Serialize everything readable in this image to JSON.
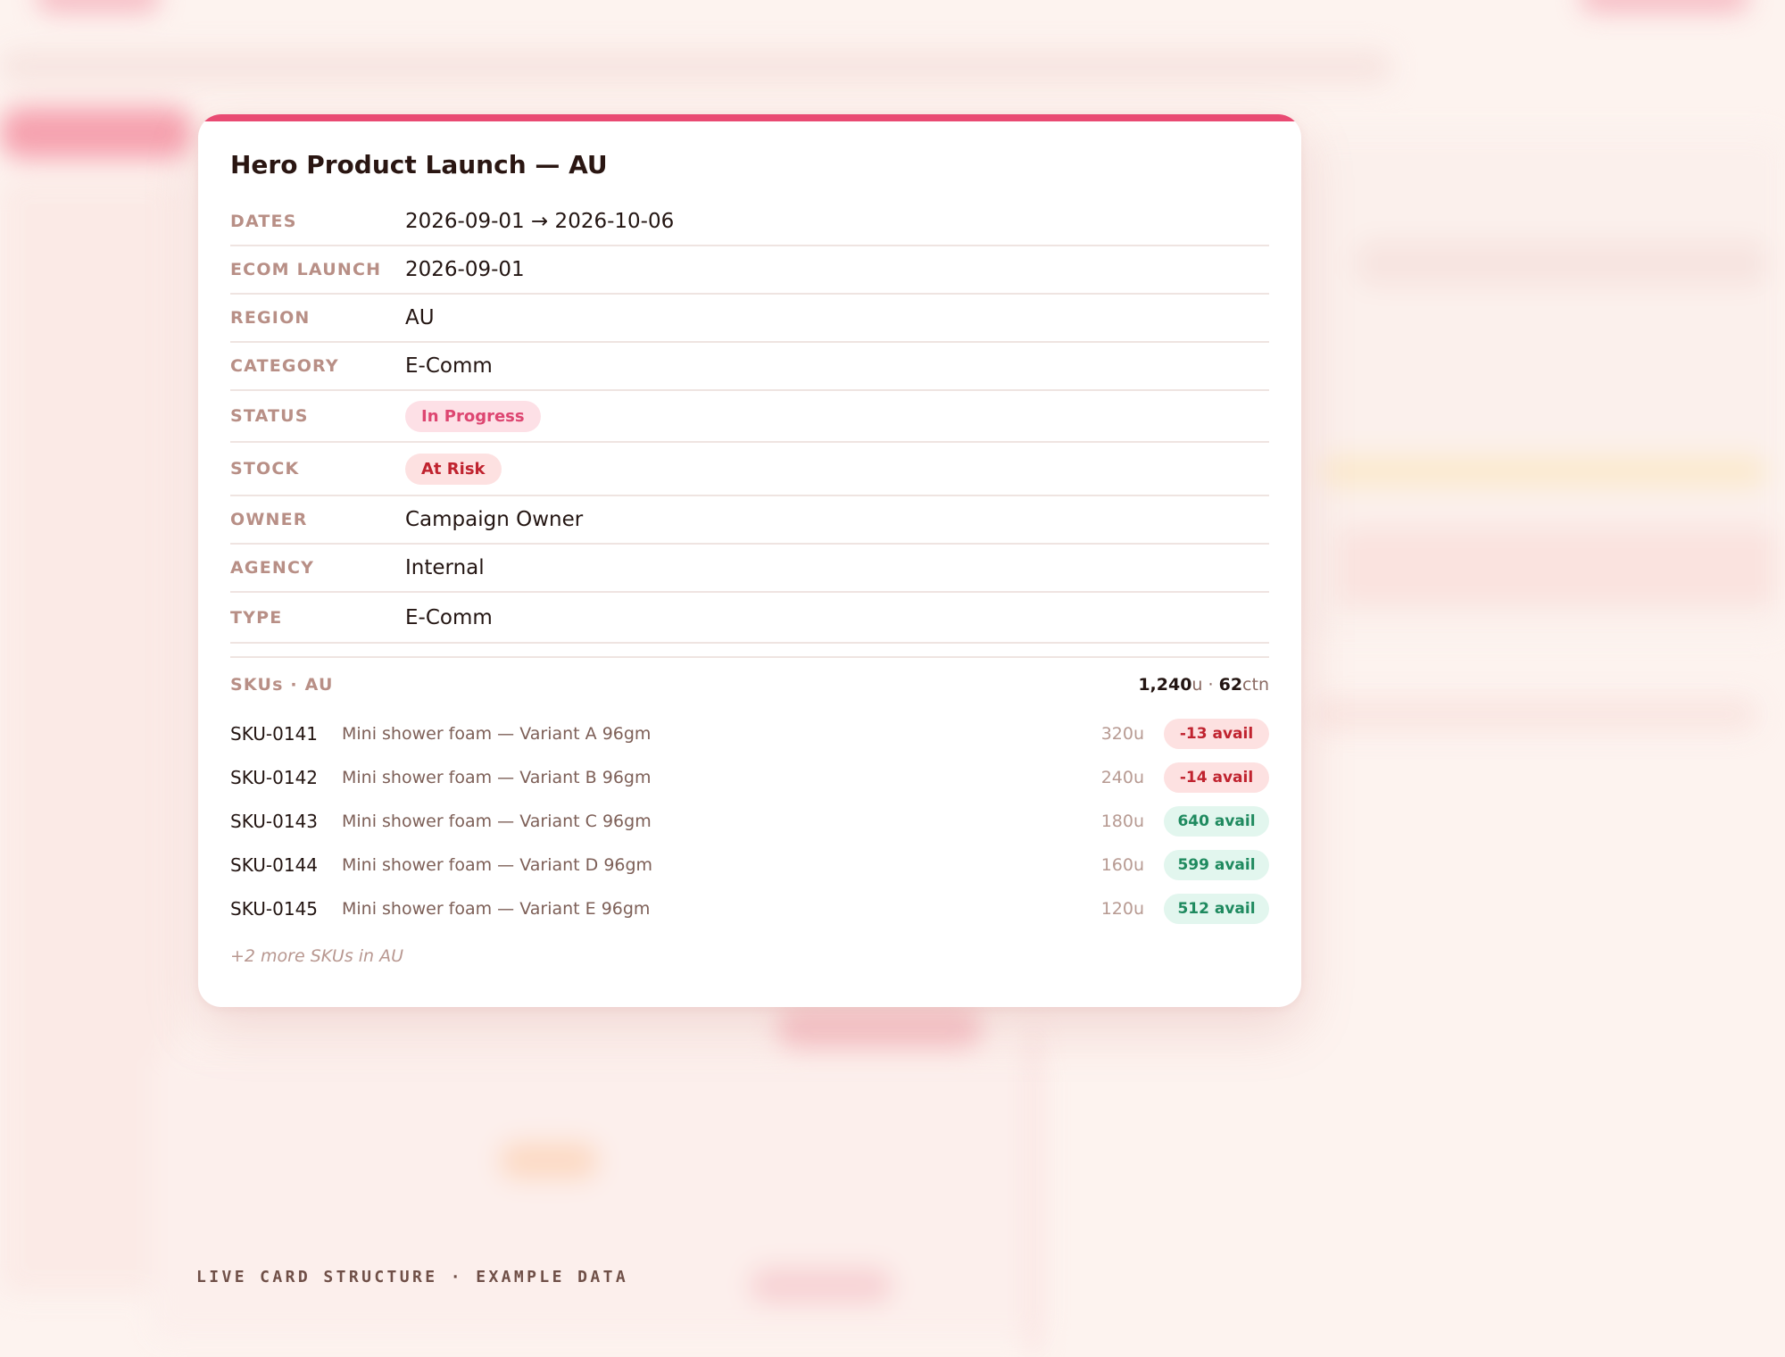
{
  "card": {
    "title": "Hero Product Launch — AU",
    "accent_color": "#e94a72",
    "details": [
      {
        "label": "DATES",
        "value": "2026-09-01 → 2026-10-06"
      },
      {
        "label": "ECOM LAUNCH",
        "value": "2026-09-01"
      },
      {
        "label": "REGION",
        "value": "AU"
      },
      {
        "label": "CATEGORY",
        "value": "E-Comm"
      },
      {
        "label": "STATUS",
        "badge": "In Progress",
        "badge_color": "#dd4671"
      },
      {
        "label": "STOCK",
        "badge": "At Risk",
        "badge_color": "#c0232f"
      },
      {
        "label": "OWNER",
        "value": "Campaign Owner"
      },
      {
        "label": "AGENCY",
        "value": "Internal"
      },
      {
        "label": "TYPE",
        "value": "E-Comm"
      }
    ],
    "skus": {
      "heading": "SKUs · AU",
      "total_units": "1,240",
      "total_units_suffix": "u",
      "separator": " · ",
      "total_cartons": "62",
      "total_cartons_suffix": "ctn",
      "items": [
        {
          "code": "SKU-0141",
          "name": "Mini shower foam — Variant A 96gm",
          "units": "320u",
          "avail": "-13 avail",
          "status": "negative"
        },
        {
          "code": "SKU-0142",
          "name": "Mini shower foam — Variant B 96gm",
          "units": "240u",
          "avail": "-14 avail",
          "status": "negative"
        },
        {
          "code": "SKU-0143",
          "name": "Mini shower foam — Variant C 96gm",
          "units": "180u",
          "avail": "640 avail",
          "status": "positive"
        },
        {
          "code": "SKU-0144",
          "name": "Mini shower foam — Variant D 96gm",
          "units": "160u",
          "avail": "599 avail",
          "status": "positive"
        },
        {
          "code": "SKU-0145",
          "name": "Mini shower foam — Variant E 96gm",
          "units": "120u",
          "avail": "512 avail",
          "status": "positive"
        }
      ],
      "more_text": "+2 more SKUs in AU"
    }
  },
  "footer": {
    "caption": "LIVE CARD STRUCTURE · EXAMPLE DATA"
  },
  "colors": {
    "background": "#fdf3ef",
    "negative": "#c0232f",
    "positive": "#1f8a5f"
  }
}
